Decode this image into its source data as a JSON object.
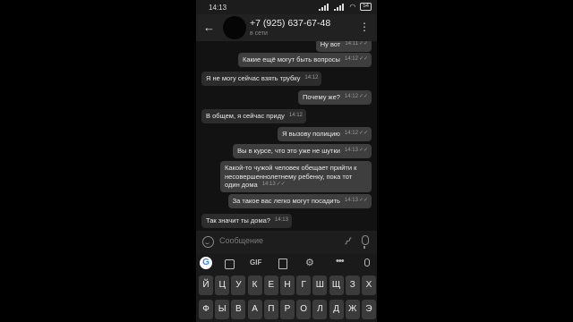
{
  "status_bar": {
    "time": "14:13",
    "battery": "54"
  },
  "header": {
    "contact_name": "+7 (925) 637-67-48",
    "contact_status": "в сети"
  },
  "messages": [
    {
      "text": "Ну вот",
      "time": "14:11",
      "direction": "out"
    },
    {
      "text": "Какие ещё могут быть вопросы",
      "time": "14:12",
      "direction": "out"
    },
    {
      "text": "Я не могу сейчас взять трубку",
      "time": "14:12",
      "direction": "in"
    },
    {
      "text": "Почему же?",
      "time": "14:12",
      "direction": "out"
    },
    {
      "text": "В общем, я сейчас приду",
      "time": "14:12",
      "direction": "in"
    },
    {
      "text": "Я вызову полицию",
      "time": "14:12",
      "direction": "out"
    },
    {
      "text": "Вы в курсе, что это уже не шутки",
      "time": "14:13",
      "direction": "out"
    },
    {
      "text": "Какой-то чужой человек обещает прийти к несовершеннолетнему ребенку, пока тот один дома",
      "time": "14:13",
      "direction": "out"
    },
    {
      "text": "За такое вас легко могут посадить",
      "time": "14:13",
      "direction": "out"
    },
    {
      "text": "Так значит ты дома?",
      "time": "14:13",
      "direction": "in"
    }
  ],
  "composer": {
    "placeholder": "Сообщение"
  },
  "keyboard": {
    "toolbar": {
      "gif_label": "GIF",
      "google_label": "G"
    },
    "row1": [
      "Й",
      "Ц",
      "У",
      "К",
      "Е",
      "Н",
      "Г",
      "Ш",
      "Щ",
      "З",
      "Х"
    ],
    "row2": [
      "Ф",
      "Ы",
      "В",
      "А",
      "П",
      "Р",
      "О",
      "Л",
      "Д",
      "Ж",
      "Э"
    ]
  },
  "icons": {
    "back": "arrow-left-icon",
    "menu": "more-vertical-icon",
    "emoji": "emoji-icon",
    "attach": "paperclip-icon",
    "mic": "microphone-icon",
    "read": "double-check-icon"
  }
}
